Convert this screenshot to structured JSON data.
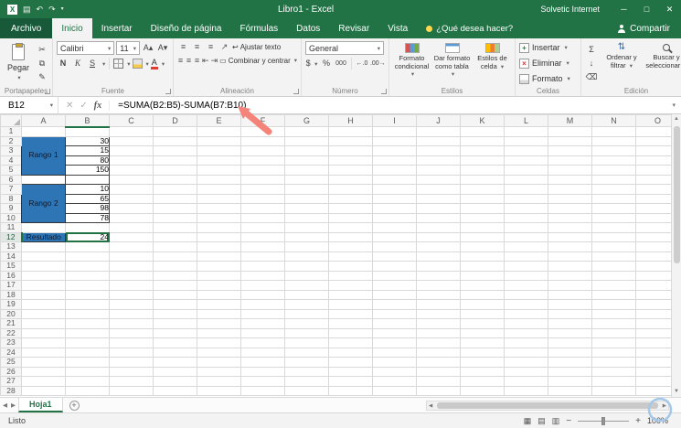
{
  "colors": {
    "accent": "#217346",
    "titlebar_green": "#217346",
    "cell_fill_blue": "#2e75b5",
    "selection_header": "#e0e8e3",
    "annotation_arrow": "#f4837a",
    "annotation_circle": "#a5c7e9"
  },
  "titlebar": {
    "title": "Libro1 - Excel",
    "user": "Solvetic Internet",
    "controls": [
      "─",
      "□",
      "✕"
    ]
  },
  "ribbon_tabs": [
    {
      "label": "Archivo"
    },
    {
      "label": "Inicio"
    },
    {
      "label": "Insertar"
    },
    {
      "label": "Diseño de página"
    },
    {
      "label": "Fórmulas"
    },
    {
      "label": "Datos"
    },
    {
      "label": "Revisar"
    },
    {
      "label": "Vista"
    }
  ],
  "tell_me": "¿Qué desea hacer?",
  "share_button": "Compartir",
  "ribbon": {
    "paste_label": "Pegar",
    "font_name": "Calibri",
    "font_size": "11",
    "font_buttons": [
      "N",
      "K",
      "S"
    ],
    "wrap_text": "Ajustar texto",
    "merge_center": "Combinar y centrar",
    "number_format": "General",
    "cond_format": "Formato condicional",
    "format_table": "Dar formato como tabla",
    "cell_styles": "Estilos de celda",
    "cells_insert": "Insertar",
    "cells_delete": "Eliminar",
    "cells_format": "Formato",
    "sort_filter": "Ordenar y filtrar",
    "find_select": "Buscar y seleccionar",
    "groups": [
      "Portapapeles",
      "Fuente",
      "Alineación",
      "Número",
      "Estilos",
      "Celdas",
      "Edición"
    ]
  },
  "formula_bar": {
    "name_box": "B12",
    "fx_label": "fx",
    "formula": "=SUMA(B2:B5)-SUMA(B7:B10)"
  },
  "sheet": {
    "columns": [
      "A",
      "B",
      "C",
      "D",
      "E",
      "F",
      "G",
      "H",
      "I",
      "J",
      "K",
      "L",
      "M",
      "N",
      "O"
    ],
    "rows": 28,
    "selected_cell": "B12",
    "selected_col": "B",
    "selected_row": 12,
    "merged_labels": [
      {
        "col": "A",
        "row_start": 2,
        "row_end": 5,
        "text": "Rango 1"
      },
      {
        "col": "A",
        "row_start": 7,
        "row_end": 10,
        "text": "Rango 2"
      },
      {
        "col": "A",
        "row_start": 12,
        "row_end": 12,
        "text": "Resultado"
      }
    ],
    "bordered_empty": [
      "A6",
      "B6"
    ],
    "values": [
      {
        "col": "B",
        "row": 2,
        "value": "30"
      },
      {
        "col": "B",
        "row": 3,
        "value": "15"
      },
      {
        "col": "B",
        "row": 4,
        "value": "80"
      },
      {
        "col": "B",
        "row": 5,
        "value": "150"
      },
      {
        "col": "B",
        "row": 7,
        "value": "10"
      },
      {
        "col": "B",
        "row": 8,
        "value": "65"
      },
      {
        "col": "B",
        "row": 9,
        "value": "98"
      },
      {
        "col": "B",
        "row": 10,
        "value": "78"
      },
      {
        "col": "B",
        "row": 12,
        "value": "24",
        "selected": true
      }
    ]
  },
  "sheet_tabs": {
    "active": "Hoja1"
  },
  "status_bar": {
    "mode": "Listo",
    "zoom": "100%"
  }
}
